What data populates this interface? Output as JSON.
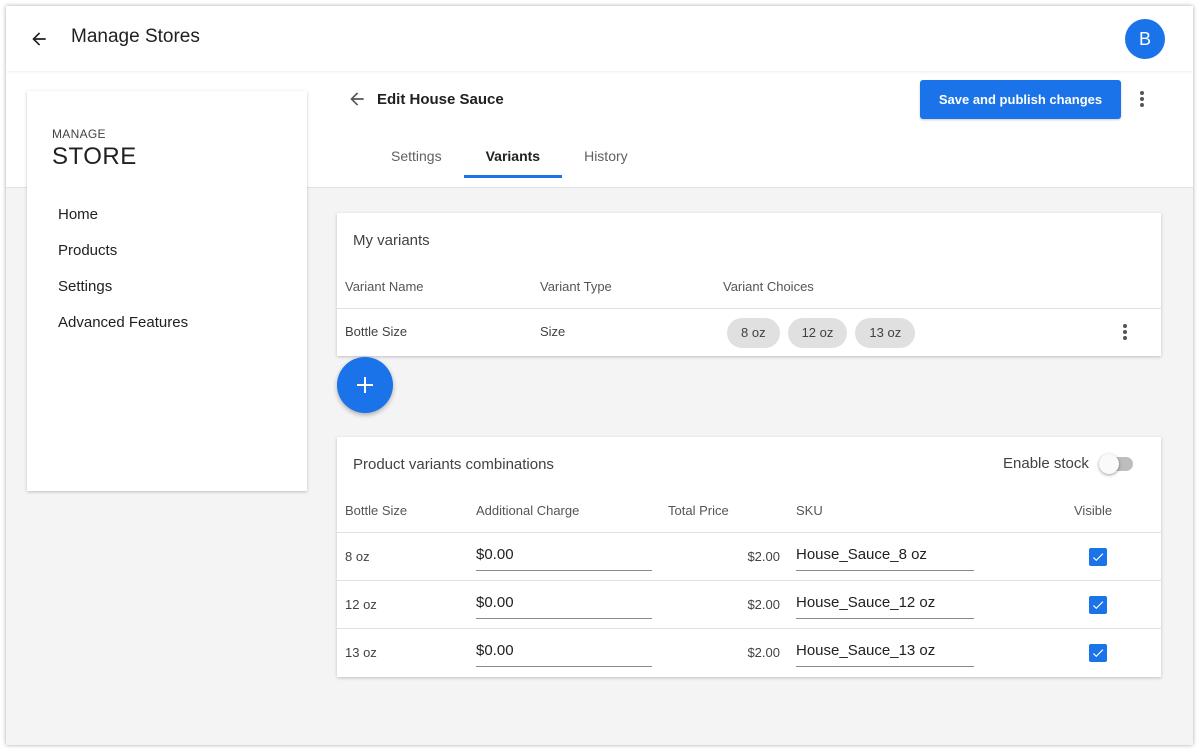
{
  "appbar": {
    "title": "Manage Stores",
    "avatar_letter": "B",
    "accent": "#1a73e8"
  },
  "sidebar": {
    "small_title": "MANAGE",
    "big_title": "STORE",
    "items": [
      {
        "label": "Home"
      },
      {
        "label": "Products"
      },
      {
        "label": "Settings"
      },
      {
        "label": "Advanced Features"
      }
    ]
  },
  "editor": {
    "title": "Edit House Sauce",
    "publish_label": "Save and publish changes",
    "tabs": [
      {
        "label": "Settings",
        "active": false
      },
      {
        "label": "Variants",
        "active": true
      },
      {
        "label": "History",
        "active": false
      }
    ]
  },
  "variants_card": {
    "title": "My variants",
    "headers": [
      "Variant Name",
      "Variant Type",
      "Variant Choices"
    ],
    "rows": [
      {
        "name": "Bottle Size",
        "type": "Size",
        "choices": [
          "8 oz",
          "12 oz",
          "13 oz"
        ]
      }
    ]
  },
  "combinations_card": {
    "title": "Product variants combinations",
    "enable_stock_label": "Enable stock",
    "enable_stock": false,
    "headers": [
      "Bottle Size",
      "Additional Charge",
      "Total Price",
      "SKU",
      "Visible"
    ],
    "rows": [
      {
        "size": "8 oz",
        "charge": "$0.00",
        "total": "$2.00",
        "sku": "House_Sauce_8 oz",
        "visible": true
      },
      {
        "size": "12 oz",
        "charge": "$0.00",
        "total": "$2.00",
        "sku": "House_Sauce_12 oz",
        "visible": true
      },
      {
        "size": "13 oz",
        "charge": "$0.00",
        "total": "$2.00",
        "sku": "House_Sauce_13 oz",
        "visible": true
      }
    ]
  },
  "icons": {
    "back": "arrow-left-icon",
    "more": "more-vertical-icon",
    "add": "plus-icon",
    "check": "check-icon"
  }
}
